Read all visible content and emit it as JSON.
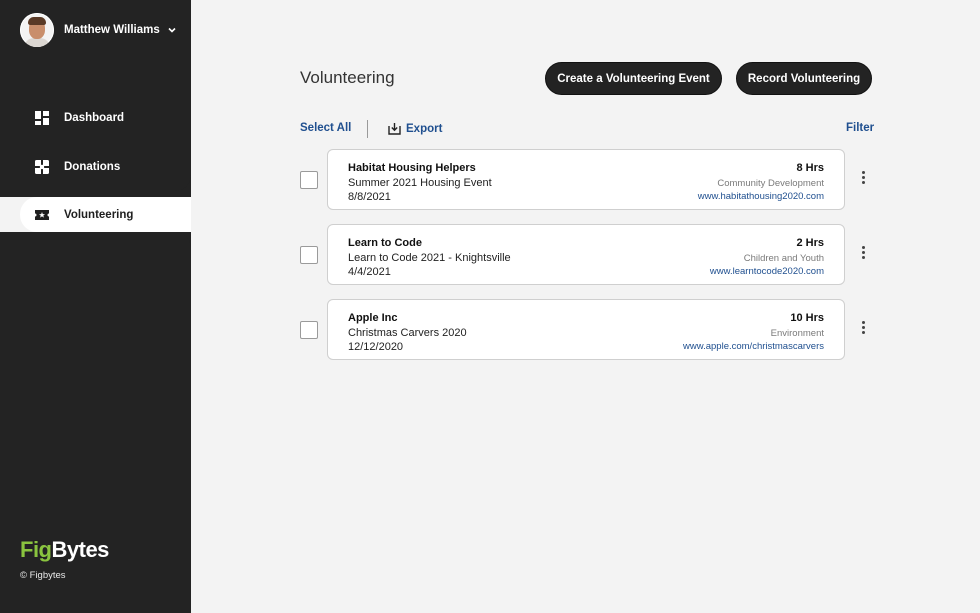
{
  "sidebar": {
    "user_name": "Matthew Williams",
    "items": [
      {
        "label": "Dashboard",
        "icon": "dashboard-icon"
      },
      {
        "label": "Donations",
        "icon": "gift-icon"
      },
      {
        "label": "Volunteering",
        "icon": "ticket-star-icon",
        "active": true
      }
    ],
    "logo_fig": "Fig",
    "logo_bytes": "Bytes",
    "copyright": "© Figbytes"
  },
  "main": {
    "title": "Volunteering",
    "create_button": "Create a Volunteering Event",
    "record_button": "Record Volunteering",
    "select_all": "Select All",
    "export": "Export",
    "filter": "Filter",
    "records": [
      {
        "org": "Habitat Housing Helpers",
        "event": "Summer 2021 Housing Event",
        "date": "8/8/2021",
        "hours": "8 Hrs",
        "category": "Community Development",
        "url": "www.habitathousing2020.com"
      },
      {
        "org": "Learn to Code",
        "event": "Learn to Code 2021 - Knightsville",
        "date": "4/4/2021",
        "hours": "2 Hrs",
        "category": "Children and Youth",
        "url": "www.learntocode2020.com"
      },
      {
        "org": "Apple Inc",
        "event": "Christmas Carvers 2020",
        "date": "12/12/2020",
        "hours": "10 Hrs",
        "category": "Environment",
        "url": "www.apple.com/christmascarvers"
      }
    ]
  },
  "colors": {
    "sidebar_bg": "#232323",
    "page_bg": "#f3f3f3",
    "link_blue": "#1f4f8f",
    "brand_green": "#8ac43f"
  }
}
